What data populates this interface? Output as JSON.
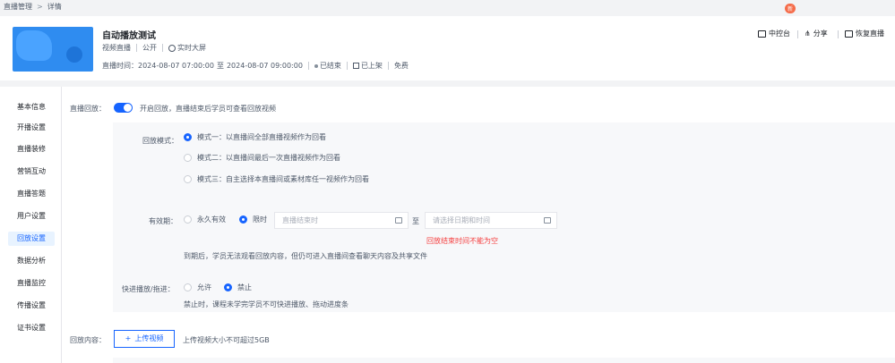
{
  "breadcrumb": {
    "parent": "直播管理",
    "separator": ">",
    "current": "详情"
  },
  "live": {
    "title": "自动播放测试",
    "type": "视频直播",
    "privacy": "公开",
    "viewers": "实时大屏",
    "time_label": "直播时间：",
    "start": "2024-08-07 07:00:00",
    "to": "至",
    "end": "2024-08-07 09:00:00",
    "status": "已结束",
    "published": "已上架",
    "price": "免费"
  },
  "header_actions": [
    {
      "label": "中控台",
      "icon": "monitor-icon",
      "badge": "新"
    },
    {
      "label": "分享",
      "icon": "share-icon"
    },
    {
      "label": "恢复直播",
      "icon": "restore-icon"
    }
  ],
  "sidebar": {
    "items": [
      {
        "label": "基本信息"
      },
      {
        "label": "开播设置"
      },
      {
        "label": "直播装修"
      },
      {
        "label": "营销互动"
      },
      {
        "label": "直播答题"
      },
      {
        "label": "用户设置"
      },
      {
        "label": "回放设置",
        "active": true
      },
      {
        "label": "数据分析"
      },
      {
        "label": "直播监控"
      },
      {
        "label": "传播设置"
      },
      {
        "label": "证书设置"
      }
    ]
  },
  "replay": {
    "label": "直播回放：",
    "enabled": true,
    "hint": "开启回放，直播结束后学员可查看回放视频",
    "mode_label": "回放模式：",
    "modes": [
      "模式一：以直播间全部直播视频作为回看",
      "模式二：以直播间最后一次直播视频作为回看",
      "模式三：自主选择本直播间或素材库任一视频作为回看"
    ],
    "selected_mode": 0,
    "validity_label": "有效期：",
    "validity_options": [
      "永久有效",
      "限时"
    ],
    "validity_selected": 1,
    "start_placeholder": "直播结束时",
    "range_sep": "至",
    "end_placeholder": "请选择日期和时间",
    "error": "回放结束时间不能为空",
    "validity_hint": "到期后，学员无法观看回放内容，但仍可进入直播间查看聊天内容及共享文件",
    "fastforward_label": "快进播放/拖进：",
    "fastforward_options": [
      "允许",
      "禁止"
    ],
    "fastforward_selected": 1,
    "fastforward_hint": "禁止时，课程未学完学员不可快进播放、拖动进度条",
    "content_label": "回放内容：",
    "upload_label": "上传视频",
    "upload_hint": "上传视频大小不可超过5GB"
  },
  "colors": {
    "primary": "#1664ff",
    "error": "#f53f3f",
    "badge": "#f56c4a"
  }
}
